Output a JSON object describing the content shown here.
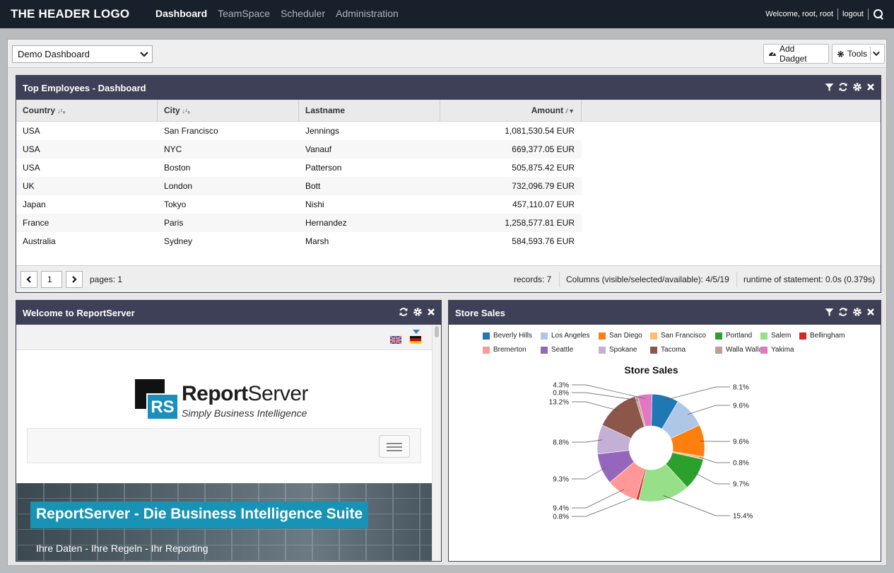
{
  "header": {
    "logo": "THE HEADER LOGO",
    "nav": [
      {
        "label": "Dashboard",
        "active": true
      },
      {
        "label": "TeamSpace",
        "active": false
      },
      {
        "label": "Scheduler",
        "active": false
      },
      {
        "label": "Administration",
        "active": false
      }
    ],
    "welcome": "Welcome, root, root",
    "logout": "logout"
  },
  "toolbar": {
    "dashboard_select": "Demo Dashboard",
    "add_dadget": "Add Dadget",
    "tools": "Tools"
  },
  "top_employees": {
    "title": "Top Employees - Dashboard",
    "columns": [
      "Country",
      "City",
      "Lastname",
      "Amount"
    ],
    "rows": [
      [
        "USA",
        "San Francisco",
        "Jennings",
        "1,081,530.54 EUR"
      ],
      [
        "USA",
        "NYC",
        "Vanauf",
        "669,377.05 EUR"
      ],
      [
        "USA",
        "Boston",
        "Patterson",
        "505,875.42 EUR"
      ],
      [
        "UK",
        "London",
        "Bott",
        "732,096.79 EUR"
      ],
      [
        "Japan",
        "Tokyo",
        "Nishi",
        "457,110.07 EUR"
      ],
      [
        "France",
        "Paris",
        "Hernandez",
        "1,258,577.81 EUR"
      ],
      [
        "Australia",
        "Sydney",
        "Marsh",
        "584,593.76 EUR"
      ]
    ],
    "pager": {
      "page": "1",
      "pages": "pages: 1",
      "records": "records: 7",
      "columns_info": "Columns (visible/selected/available): 4/5/19",
      "runtime": "runtime of statement: 0.0s (0.379s)"
    }
  },
  "welcome_panel": {
    "title": "Welcome to ReportServer",
    "logo_mark": "RS",
    "logo_word_bold": "Report",
    "logo_word_rest": "Server",
    "logo_tagline": "Simply Business Intelligence",
    "hero_title": "ReportServer - Die Business Intelligence Suite",
    "hero_subtitle": "Ihre Daten - Ihre Regeln - Ihr Reporting"
  },
  "store_sales": {
    "title": "Store Sales"
  },
  "chart_data": {
    "type": "pie",
    "title": "Store Sales",
    "legend_placement": "top",
    "categories": [
      "Beverly Hills",
      "Los Angeles",
      "San Diego",
      "San Francisco",
      "Portland",
      "Salem",
      "Bellingham",
      "Bremerton",
      "Seattle",
      "Spokane",
      "Tacoma",
      "Walla Walla",
      "Yakima"
    ],
    "values": [
      8.1,
      9.6,
      9.6,
      0.8,
      9.7,
      15.4,
      0.8,
      9.4,
      9.3,
      8.8,
      13.2,
      0.8,
      4.3
    ],
    "labels": [
      "8.1%",
      "9.6%",
      "9.6%",
      "0.8%",
      "9.7%",
      "15.4%",
      "0.8%",
      "9.4%",
      "9.3%",
      "8.8%",
      "13.2%",
      "0.8%",
      "4.3%"
    ],
    "colors": [
      "#1f77b4",
      "#aec7e8",
      "#ff7f0e",
      "#ffbb78",
      "#2ca02c",
      "#98df8a",
      "#d62728",
      "#ff9896",
      "#9467bd",
      "#c5b0d5",
      "#8c564b",
      "#c49c94",
      "#e377c2"
    ]
  }
}
